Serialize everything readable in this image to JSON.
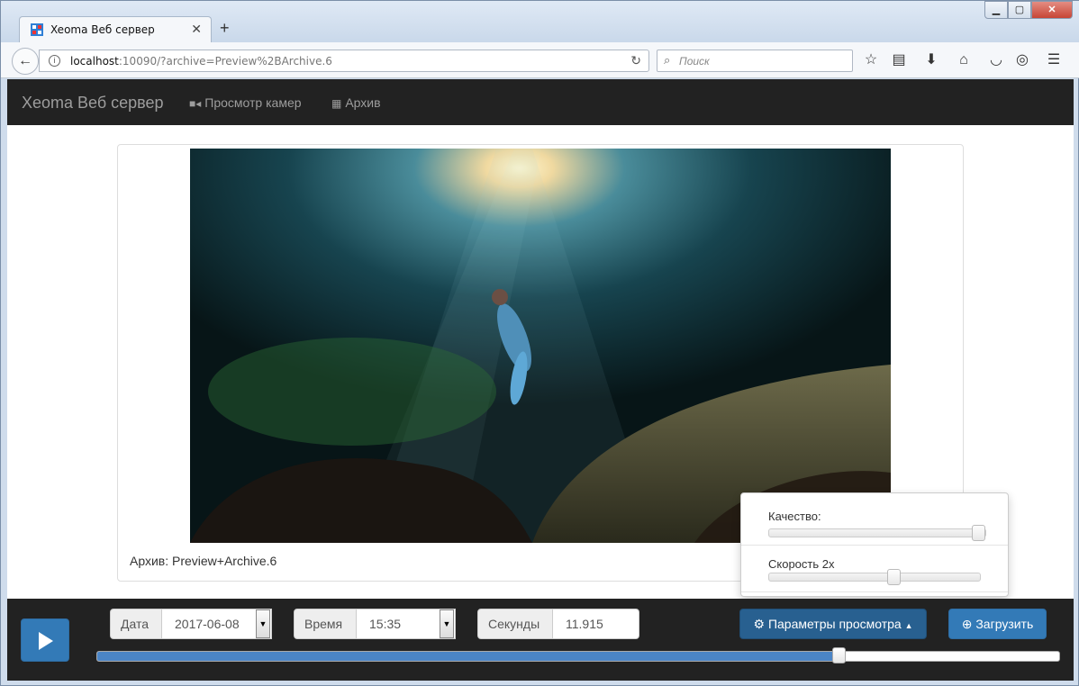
{
  "browser": {
    "tab_title": "Xeoma Веб сервер",
    "url_host": "localhost",
    "url_rest": ":10090/?archive=Preview%2BArchive.6",
    "search_placeholder": "Поиск"
  },
  "app": {
    "brand": "Xeoma Веб сервер",
    "nav": [
      {
        "label": "Просмотр камер",
        "icon": "video-camera-icon"
      },
      {
        "label": "Архив",
        "icon": "film-icon"
      }
    ]
  },
  "viewer": {
    "caption": "Архив: Preview+Archive.6"
  },
  "settings_dropdown": {
    "quality_label": "Качество:",
    "quality_value": 1.0,
    "speed_label": "Скорость 2x",
    "speed_value": 0.6
  },
  "controls": {
    "date_label": "Дата",
    "date_value": "2017-06-08",
    "time_label": "Время",
    "time_value": "15:35",
    "seconds_label": "Секунды",
    "seconds_value": "11.915",
    "settings_button": "Параметры просмотра",
    "download_button": "Загрузить",
    "progress": 0.775
  },
  "colors": {
    "accent": "#337ab7",
    "navbar": "#222222"
  }
}
